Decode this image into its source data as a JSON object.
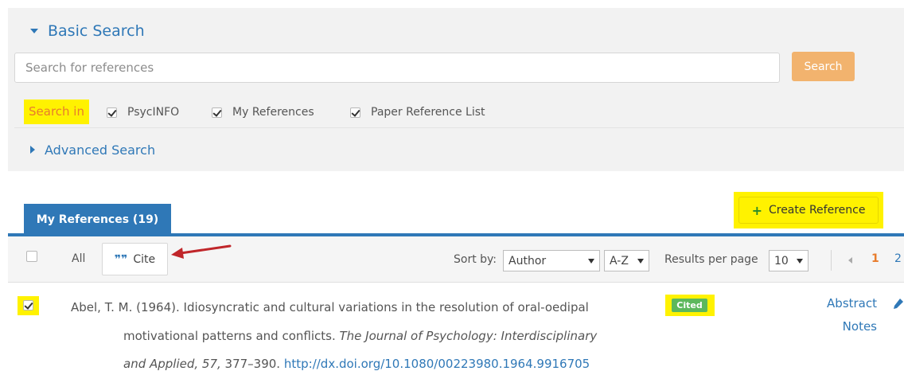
{
  "basic_search": {
    "label": "Basic Search"
  },
  "search": {
    "placeholder": "Search for references",
    "button_label": "Search",
    "search_in_label": "Search in",
    "sources": [
      {
        "label": "PsycINFO",
        "checked": true
      },
      {
        "label": "My References",
        "checked": true
      },
      {
        "label": "Paper Reference List",
        "checked": true
      }
    ]
  },
  "advanced_search": {
    "label": "Advanced Search"
  },
  "tabs": {
    "my_references_label": "My References (19)"
  },
  "create_reference": {
    "label": "Create Reference",
    "icon": "plus-icon"
  },
  "toolbar": {
    "all_label": "All",
    "cite_label": "Cite",
    "cite_icon": "quote-icon",
    "sort_by_label": "Sort by:",
    "sort_field": "Author",
    "sort_order": "A-Z",
    "results_per_page_label": "Results per page",
    "results_per_page": "10",
    "pages": [
      "1",
      "2"
    ],
    "current_page": "1"
  },
  "result": {
    "checked": true,
    "citation_line1": "Abel, T. M. (1964). Idiosyncratic and cultural variations in the resolution of oral-oedipal",
    "citation_line2_plain": "motivational patterns and conflicts. ",
    "citation_journal_part1": "The Journal of Psychology: Interdisciplinary",
    "citation_journal_part2": "and Applied, 57,",
    "citation_pages": " 377–390. ",
    "doi_link": "http://dx.doi.org/10.1080/00223980.1964.9916705",
    "cited_badge": "Cited",
    "abstract_link": "Abstract",
    "notes_link": "Notes"
  },
  "colors": {
    "accent": "#2f78b7",
    "search_button": "#f2b36e",
    "highlight": "#fff200",
    "cited_badge": "#5cb85c",
    "annotation_arrow": "#c0262a"
  }
}
